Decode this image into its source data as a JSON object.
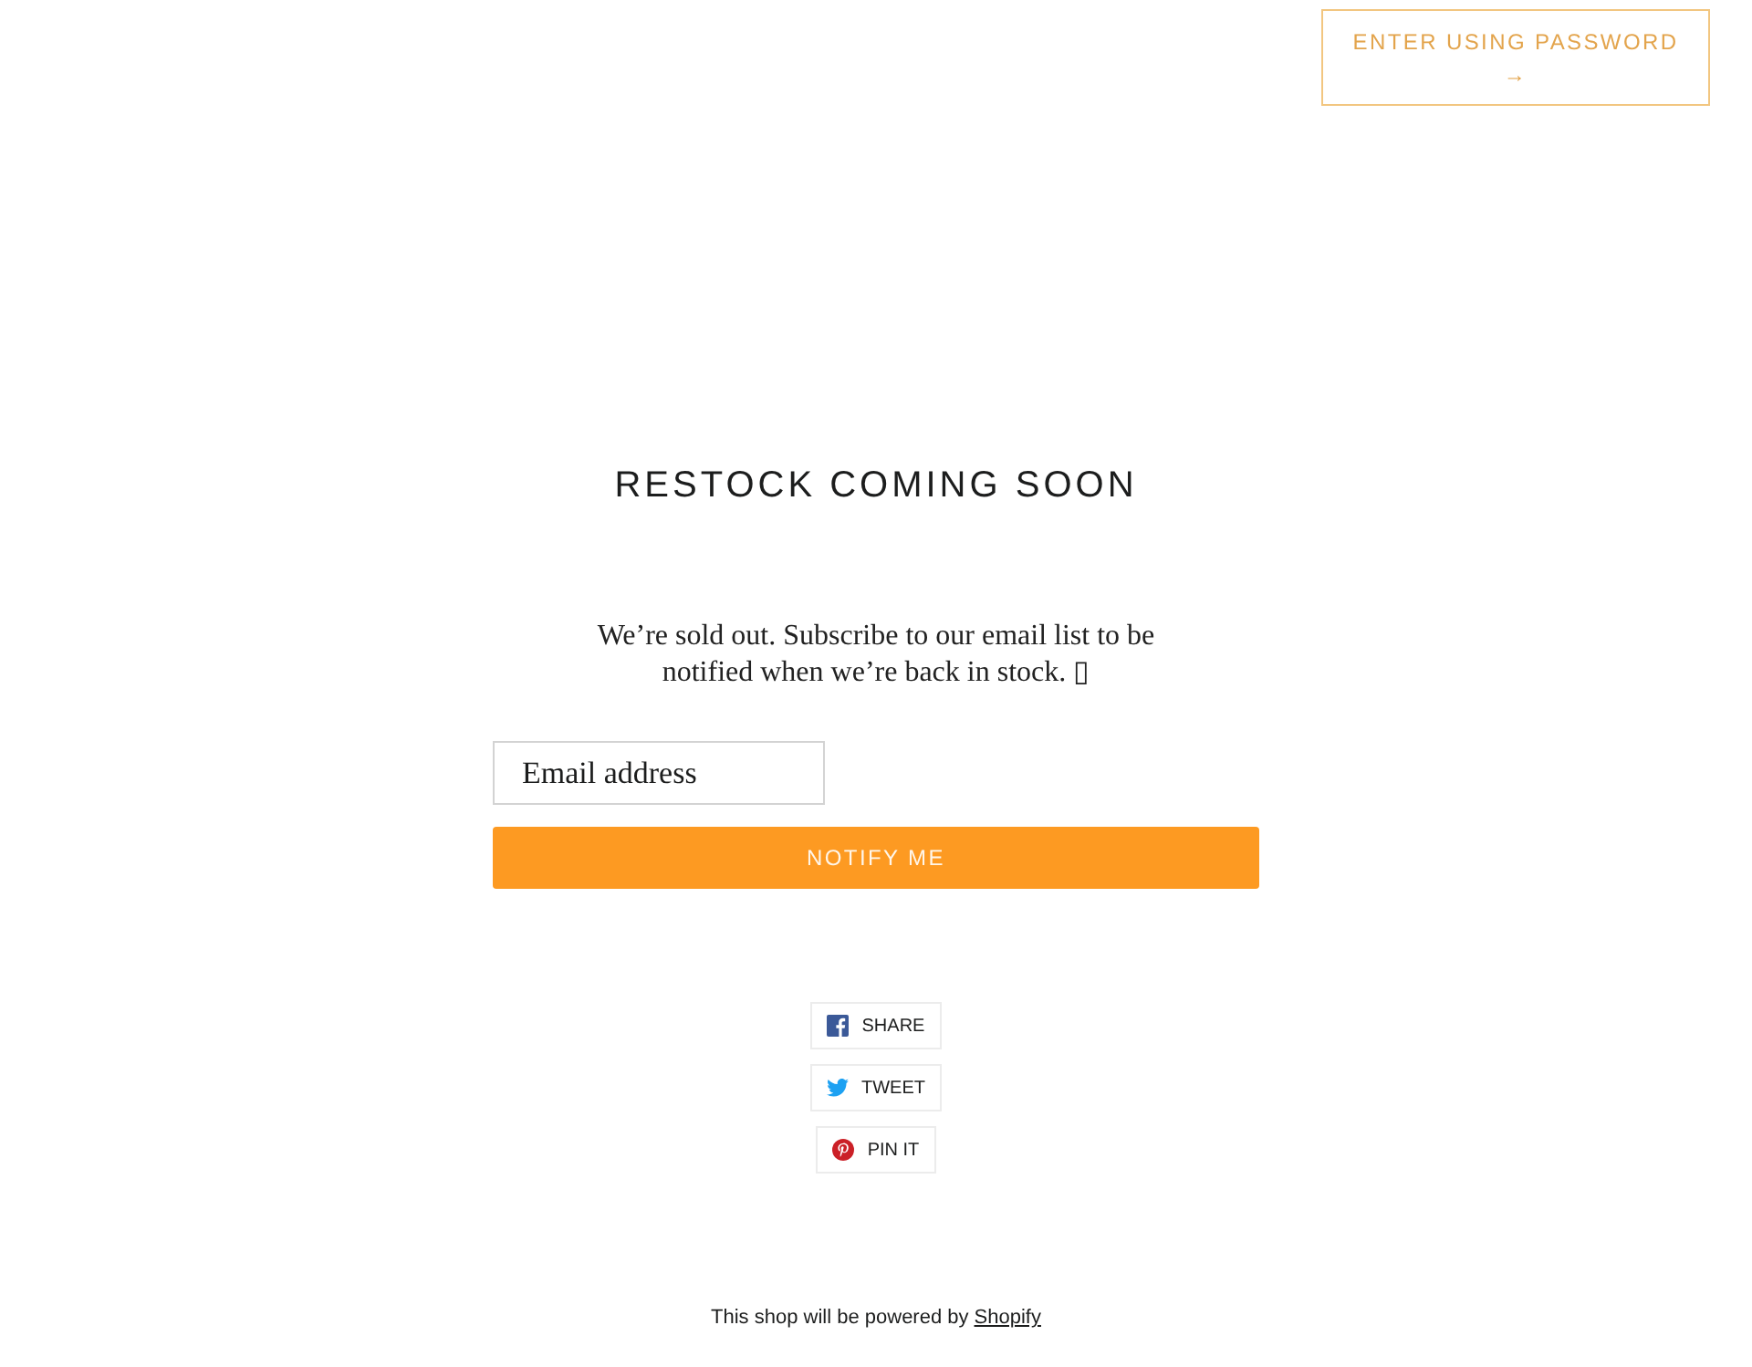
{
  "header": {
    "password_button": {
      "label": "ENTER USING PASSWORD",
      "arrow": "→"
    }
  },
  "heading": "RESTOCK COMING SOON",
  "message": "We’re sold out. Subscribe to our email list to be notified when we’re back in stock. ▯",
  "signup": {
    "email_field": {
      "placeholder": "Email address"
    },
    "submit_button": "NOTIFY ME"
  },
  "share_buttons": [
    {
      "kind": "facebook",
      "label": "SHARE"
    },
    {
      "kind": "twitter",
      "label": "TWEET"
    },
    {
      "kind": "pinterest",
      "label": "PIN IT"
    }
  ],
  "footer": {
    "text": "This shop will be powered by",
    "link": "Shopify"
  }
}
